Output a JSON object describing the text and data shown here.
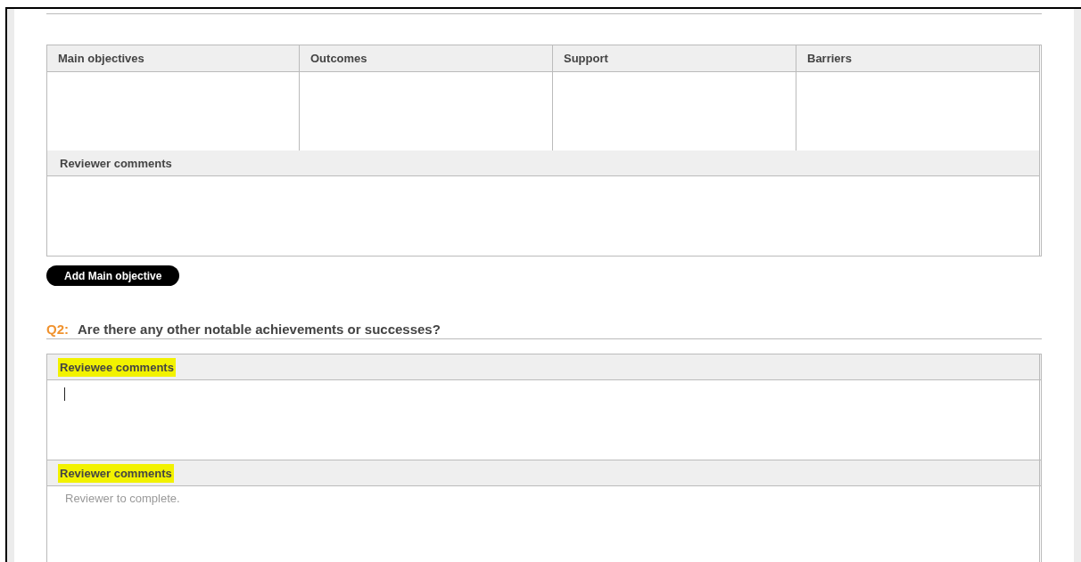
{
  "objectives_table": {
    "columns": [
      "Main objectives",
      "Outcomes",
      "Support",
      "Barriers"
    ],
    "reviewer_comments": {
      "label": "Reviewer comments",
      "highlighted": false
    }
  },
  "add_button": {
    "label": "Add Main objective"
  },
  "question": {
    "number": "Q2:",
    "text": "Are there any other notable achievements or successes?"
  },
  "comment_fields": [
    {
      "label": "Reviewee comments",
      "highlighted": true,
      "focused": true
    },
    {
      "label": "Reviewer comments",
      "highlighted": true,
      "focused": false,
      "placeholder": "Reviewer to complete."
    }
  ]
}
